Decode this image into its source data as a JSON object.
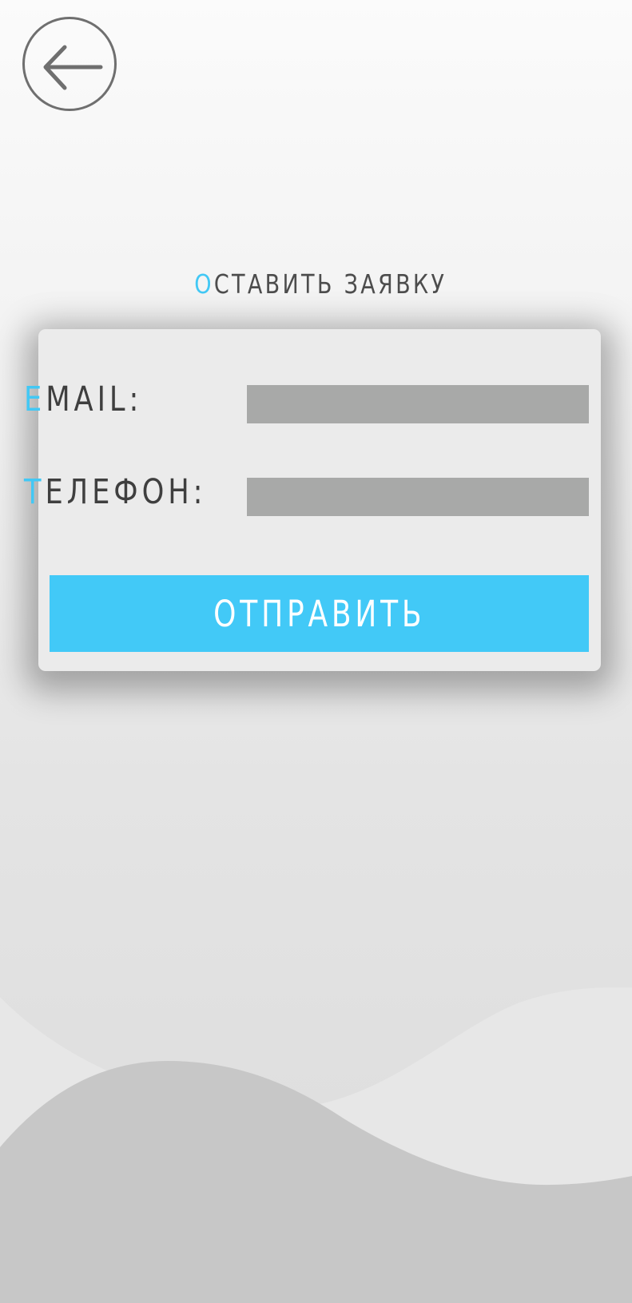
{
  "header": {
    "back_icon": "arrow-left-icon"
  },
  "title": {
    "first_letter": "О",
    "rest": "СТАВИТЬ ЗАЯВКУ"
  },
  "form": {
    "email_label_first": "E",
    "email_label_rest": "MAIL:",
    "email_value": "",
    "phone_label_first": "Т",
    "phone_label_rest": "ЕЛЕФОН:",
    "phone_value": "",
    "submit_label": "ОТПРАВИТЬ"
  },
  "colors": {
    "accent": "#42c8f5",
    "input_bg": "#a8a9a8",
    "card_bg": "#ebebeb",
    "text": "#3f3f3f"
  }
}
